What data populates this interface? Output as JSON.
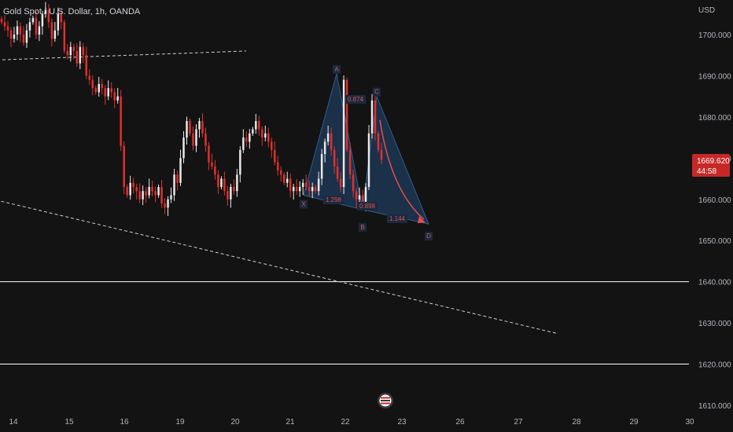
{
  "header": {
    "title": "Gold Spot / U.S. Dollar, 1h, OANDA"
  },
  "price_axis": {
    "currency": "USD",
    "current_price": "1669.620",
    "countdown": "44:58"
  },
  "colors": {
    "background": "#131313",
    "up_candle": "#e9e9e9",
    "down_candle": "#e0312f",
    "pattern_fill": "#1f3b5c",
    "pattern_label": "#e05050",
    "price_tag": "#c62828",
    "dashed_trend": "#cfcfcf",
    "horizontal_level": "#ffffff"
  },
  "chart_data": {
    "type": "candlestick",
    "title": "Gold Spot / U.S. Dollar, 1h, OANDA",
    "symbol": "XAUUSD",
    "timeframe": "1h",
    "source": "OANDA",
    "ylabel": "USD",
    "ylim": [
      1608,
      1712
    ],
    "y_ticks": [
      1610,
      1620,
      1630,
      1640,
      1650,
      1660,
      1670,
      1680,
      1690,
      1700
    ],
    "y_tick_labels": [
      "1610.000",
      "1620.000",
      "1630.000",
      "1640.000",
      "1650.000",
      "1660.000",
      "1670.000",
      "1680.000",
      "1690.000",
      "1700.000"
    ],
    "x_ticks": [
      "14",
      "15",
      "16",
      "19",
      "20",
      "21",
      "22",
      "23",
      "26",
      "27",
      "28",
      "29",
      "30"
    ],
    "current_price": 1669.62,
    "horizontal_levels": [
      1640.0,
      1620.0
    ],
    "trend_lines": [
      {
        "from": {
          "x": "13",
          "y": 1693.5
        },
        "to": {
          "x": "20",
          "y": 1696.0
        },
        "style": "dashed"
      },
      {
        "from": {
          "x": "13",
          "y": 1662.0
        },
        "to": {
          "x": "27",
          "y": 1627.5
        },
        "style": "dashed"
      }
    ],
    "harmonic_pattern": {
      "points": {
        "X": 1661.0,
        "A": 1690.5,
        "B": 1657.5,
        "C": 1685.0,
        "D": 1654.0
      },
      "ratios": [
        "0.874",
        "1.298",
        "0.898",
        "1.144"
      ]
    },
    "closes": [
      1703,
      1702,
      1701,
      1699,
      1700,
      1702,
      1700,
      1698,
      1701,
      1703,
      1704,
      1700,
      1702,
      1705,
      1706,
      1703,
      1699,
      1701,
      1705,
      1703,
      1696,
      1695,
      1697,
      1696,
      1693,
      1697,
      1695,
      1690,
      1689,
      1687,
      1686,
      1688,
      1687,
      1685,
      1687,
      1686,
      1684,
      1685,
      1673,
      1663,
      1661,
      1664,
      1663,
      1662,
      1660,
      1662,
      1661,
      1663,
      1662,
      1661,
      1663,
      1659,
      1658,
      1660,
      1661,
      1666,
      1664,
      1670,
      1675,
      1679,
      1676,
      1673,
      1677,
      1679,
      1676,
      1673,
      1669,
      1668,
      1666,
      1663,
      1665,
      1662,
      1660,
      1663,
      1662,
      1666,
      1672,
      1675,
      1674,
      1676,
      1677,
      1679,
      1677,
      1675,
      1676,
      1674,
      1672,
      1669,
      1667,
      1666,
      1664,
      1665,
      1662,
      1663,
      1662,
      1663,
      1664,
      1663,
      1662,
      1663,
      1662,
      1665,
      1671,
      1674,
      1676,
      1672,
      1668,
      1665,
      1663,
      1689,
      1672,
      1666,
      1662,
      1660,
      1661,
      1659,
      1663,
      1676,
      1684,
      1676,
      1672,
      1669.6
    ]
  }
}
